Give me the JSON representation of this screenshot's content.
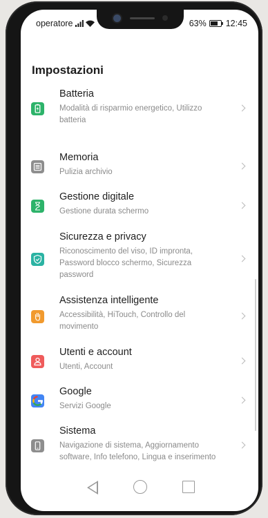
{
  "status_bar": {
    "carrier": "operatore",
    "battery_percent": "63%",
    "time": "12:45"
  },
  "header": {
    "title": "Impostazioni"
  },
  "settings": [
    {
      "title": "Batteria",
      "subtitle": "Modalità di risparmio energetico, Utilizzo batteria",
      "icon": "battery-icon",
      "color": "#2db36a"
    },
    {
      "title": "Memoria",
      "subtitle": "Pulizia archivio",
      "icon": "storage-icon",
      "color": "#8e8e8e"
    },
    {
      "title": "Gestione digitale",
      "subtitle": "Gestione durata schermo",
      "icon": "hourglass-icon",
      "color": "#2db36a"
    },
    {
      "title": "Sicurezza e privacy",
      "subtitle": "Riconoscimento del viso, ID impronta, Password blocco schermo, Sicurezza password",
      "icon": "shield-icon",
      "color": "#2bb3a3"
    },
    {
      "title": "Assistenza intelligente",
      "subtitle": "Accessibilità, HiTouch, Controllo del movimento",
      "icon": "hand-icon",
      "color": "#f19a2e"
    },
    {
      "title": "Utenti e account",
      "subtitle": "Utenti, Account",
      "icon": "user-icon",
      "color": "#ef5b5b"
    },
    {
      "title": "Google",
      "subtitle": "Servizi Google",
      "icon": "google-icon",
      "color": "#4285f4"
    },
    {
      "title": "Sistema",
      "subtitle": "Navigazione di sistema, Aggiornamento software, Info telefono, Lingua e inserimento",
      "icon": "phone-icon",
      "color": "#8e8e8e"
    }
  ],
  "nav_bar": {
    "back": "back-icon",
    "home": "home-icon",
    "recents": "recents-icon"
  }
}
